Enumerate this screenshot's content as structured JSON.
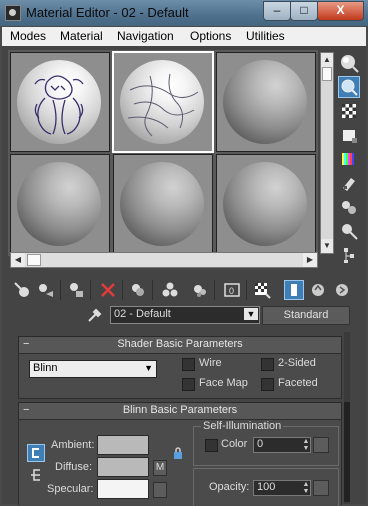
{
  "window": {
    "title": "Material Editor - 02 - Default",
    "minimize": "–",
    "maximize": "□",
    "close": "X"
  },
  "menu": [
    "Modes",
    "Material",
    "Navigation",
    "Options",
    "Utilities"
  ],
  "slots": [
    {
      "id": 1,
      "state": "textured"
    },
    {
      "id": 2,
      "state": "textured-selected"
    },
    {
      "id": 3,
      "state": "default"
    },
    {
      "id": 4,
      "state": "default"
    },
    {
      "id": 5,
      "state": "default"
    },
    {
      "id": 6,
      "state": "default"
    }
  ],
  "side_toolbar": [
    {
      "icon": "sample-type-sphere-icon"
    },
    {
      "icon": "backlight-icon",
      "active": true
    },
    {
      "icon": "background-checker-icon"
    },
    {
      "icon": "sample-uv-tiling-icon"
    },
    {
      "icon": "video-color-check-icon"
    },
    {
      "icon": "make-preview-icon"
    },
    {
      "icon": "options-icon"
    },
    {
      "icon": "select-by-material-icon"
    },
    {
      "icon": "material-map-navigator-icon"
    }
  ],
  "bottom_toolbar": [
    {
      "icon": "get-material-icon"
    },
    {
      "icon": "put-to-scene-icon"
    },
    {
      "icon": "assign-to-selection-icon"
    },
    {
      "icon": "reset-map-icon"
    },
    {
      "icon": "make-copy-icon"
    },
    {
      "icon": "make-unique-icon"
    },
    {
      "icon": "put-to-library-icon"
    },
    {
      "icon": "material-id-channel-icon"
    },
    {
      "icon": "show-shaded-in-viewport-icon"
    },
    {
      "icon": "show-end-result-icon",
      "active": true
    },
    {
      "icon": "go-to-parent-icon"
    },
    {
      "icon": "go-forward-to-sibling-icon"
    }
  ],
  "material_name": "02 - Default",
  "material_type": "Standard",
  "shader_basic": {
    "header": "Shader Basic Parameters",
    "shader": "Blinn",
    "options": [
      {
        "label": "Wire",
        "checked": false
      },
      {
        "label": "2-Sided",
        "checked": false
      },
      {
        "label": "Face Map",
        "checked": false
      },
      {
        "label": "Faceted",
        "checked": false
      }
    ]
  },
  "blinn_basic": {
    "header": "Blinn Basic Parameters",
    "ambient_label": "Ambient:",
    "diffuse_label": "Diffuse:",
    "specular_label": "Specular:",
    "m_label": "M",
    "self_illum_group": "Self-Illumination",
    "color_label": "Color",
    "color_value": "0",
    "opacity_label": "Opacity:",
    "opacity_value": "100"
  },
  "colors": {
    "accent": "#3f7fb5",
    "title_bar": "#4f718d",
    "panel": "#4b4b4b"
  }
}
